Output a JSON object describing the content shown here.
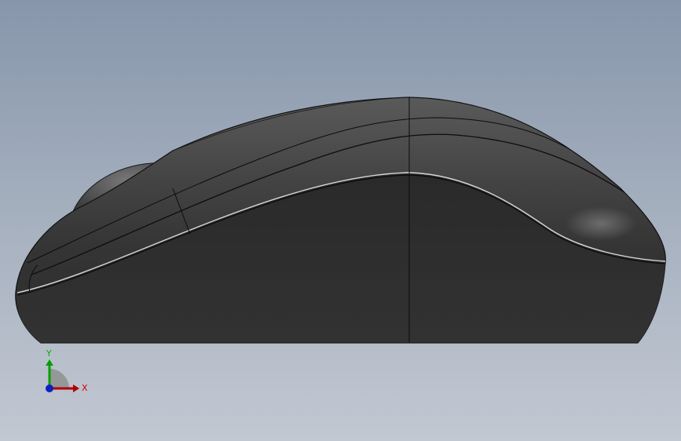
{
  "colors": {
    "background_top": "#8796ab",
    "background_bottom": "#c2c8d2",
    "model_body": "#2f2f2f",
    "model_top": "#4a4a4a",
    "edge_line": "#0c0c0c",
    "axis_x": "#cc0000",
    "axis_y": "#00a000",
    "axis_z": "#0000cc"
  },
  "triad": {
    "x_label": "X",
    "y_label": "Y"
  }
}
